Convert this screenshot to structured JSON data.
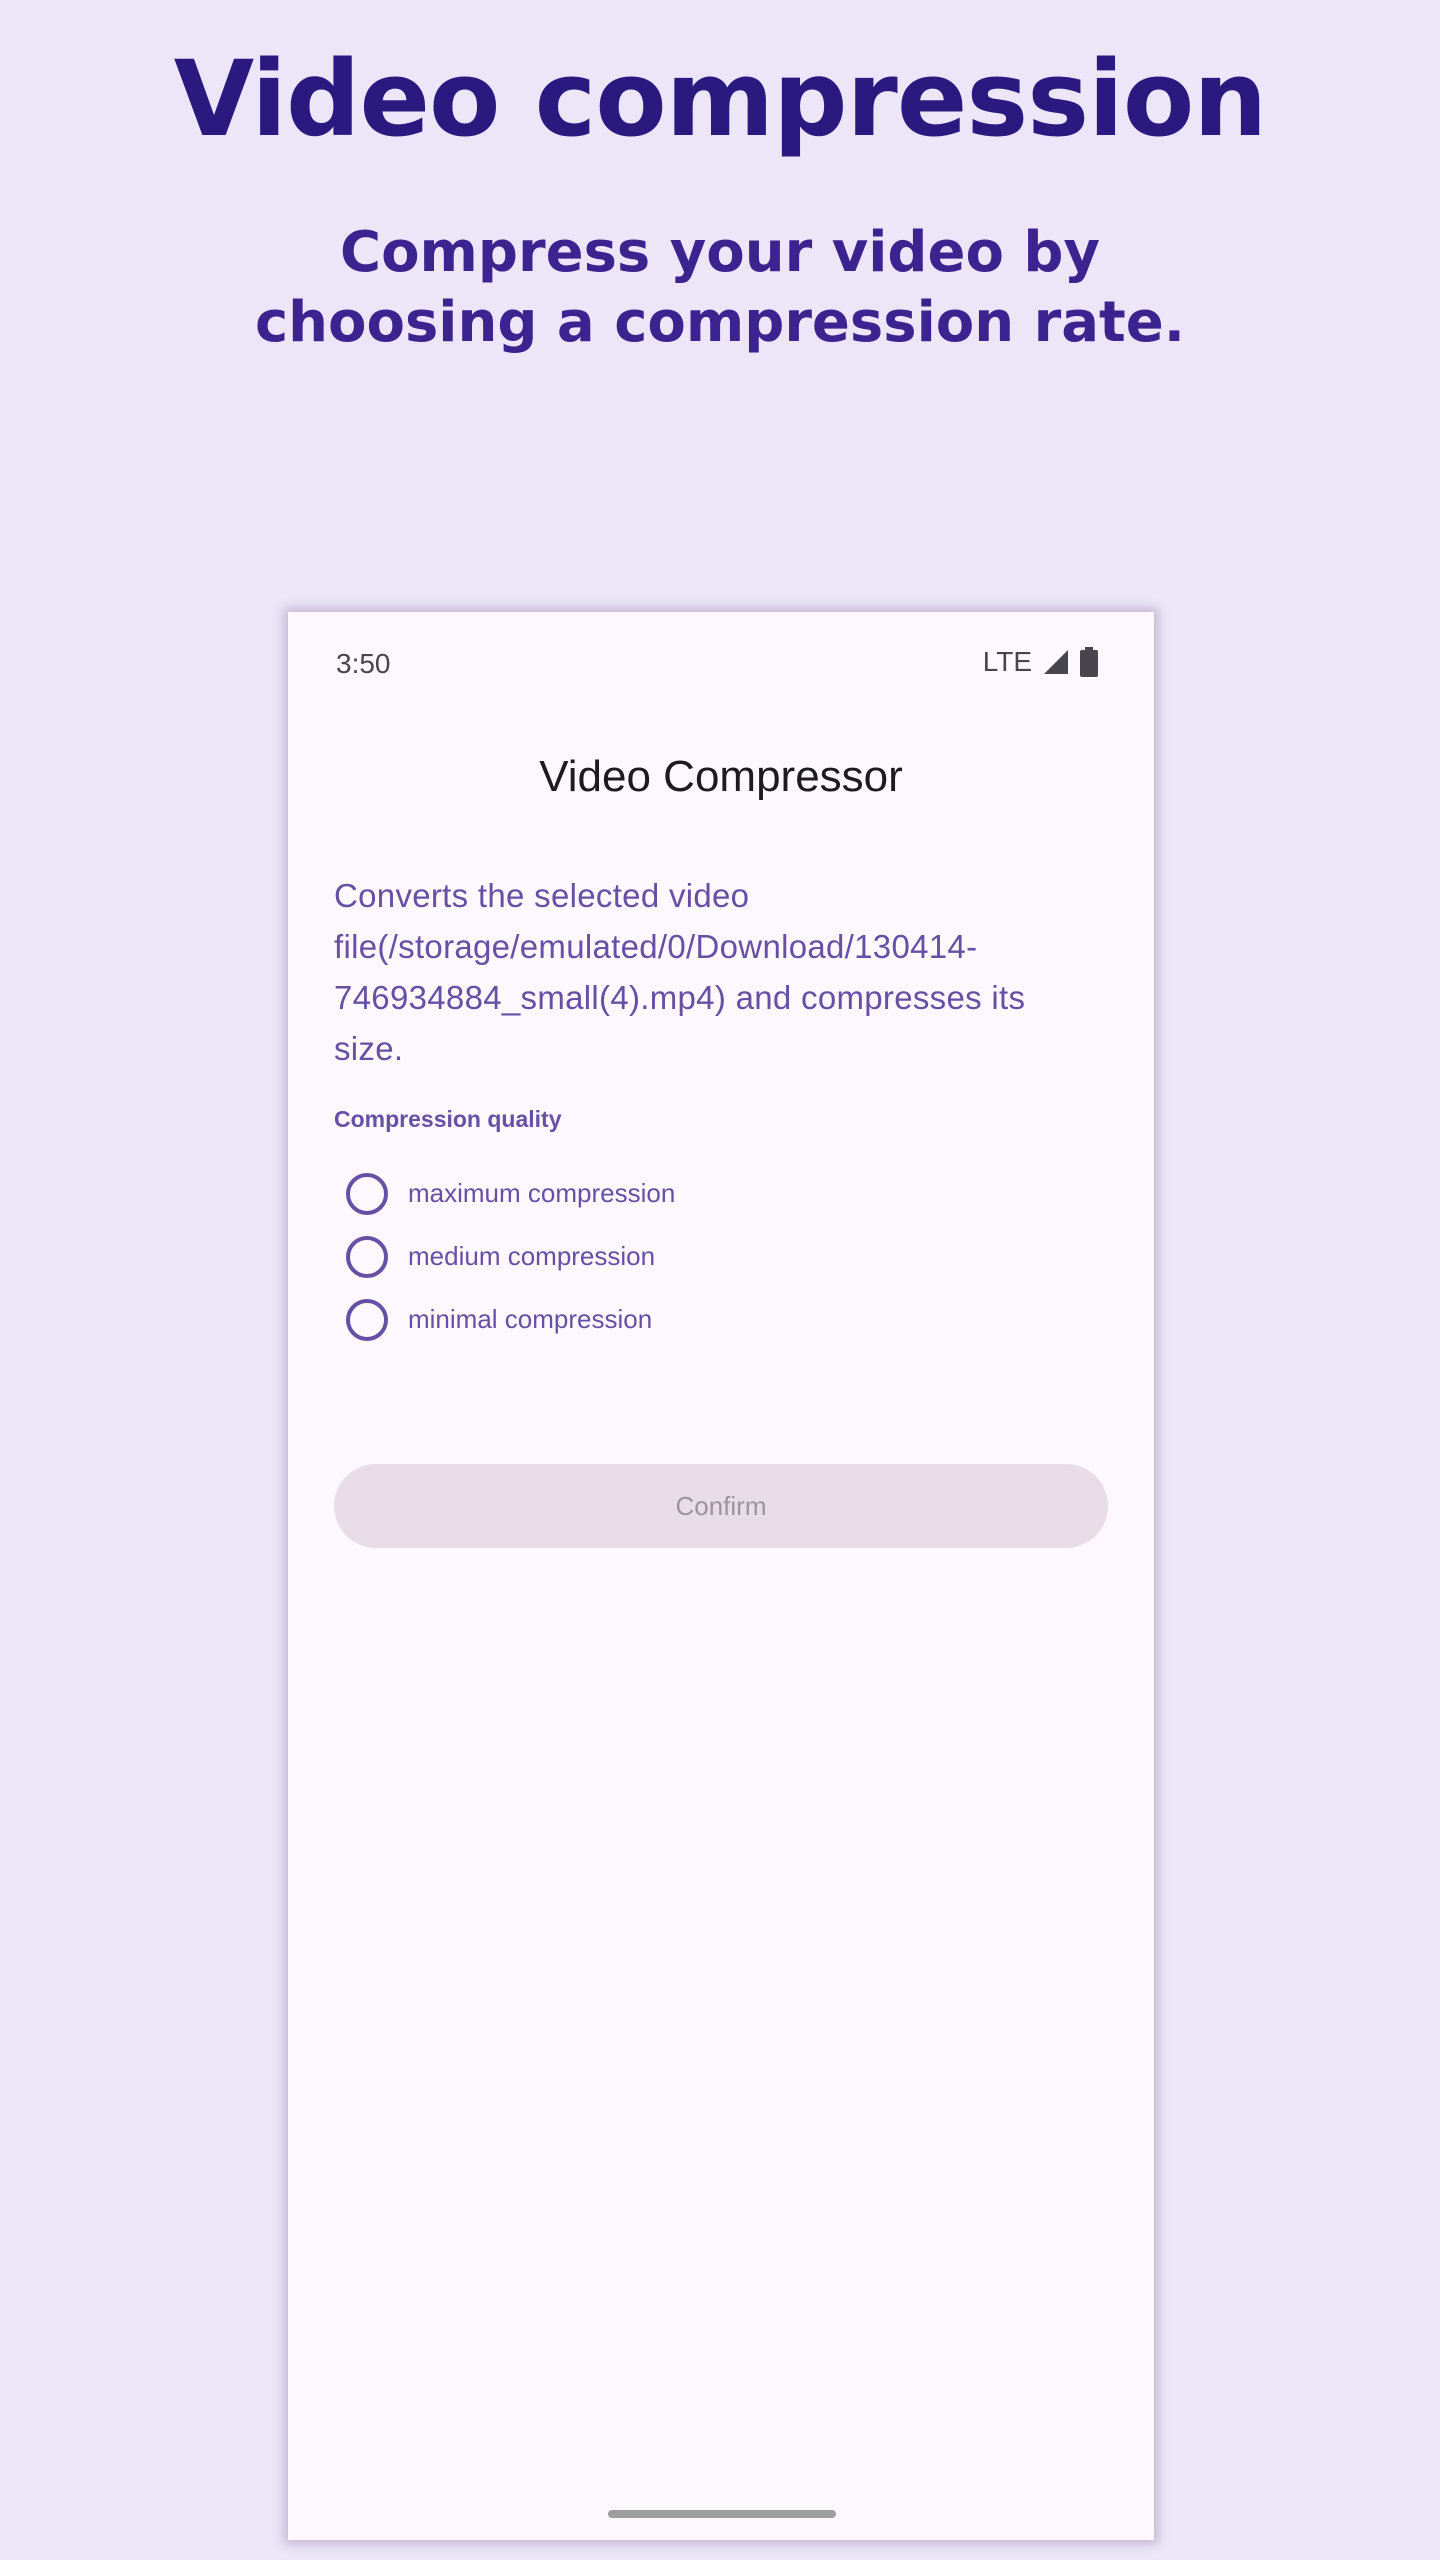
{
  "hero": {
    "title": "Video compression",
    "subtitle": "Compress your video by choosing a compression rate."
  },
  "status_bar": {
    "time": "3:50",
    "network": "LTE",
    "icons": [
      "signal-icon",
      "battery-icon"
    ]
  },
  "app": {
    "title": "Video Compressor",
    "description": "Converts the selected video file(/storage/emulated/0/Download/130414-746934884_small(4).mp4) and compresses its size.",
    "quality_label": "Compression quality",
    "options": [
      {
        "label": "maximum compression",
        "selected": false
      },
      {
        "label": "medium compression",
        "selected": false
      },
      {
        "label": "minimal compression",
        "selected": false
      }
    ],
    "confirm_label": "Confirm",
    "confirm_enabled": false
  },
  "colors": {
    "background": "#ece6f8",
    "hero_title": "#2a1a80",
    "accent": "#6750a4",
    "surface": "#fdf7fe",
    "disabled_button": "#e8dde6"
  }
}
